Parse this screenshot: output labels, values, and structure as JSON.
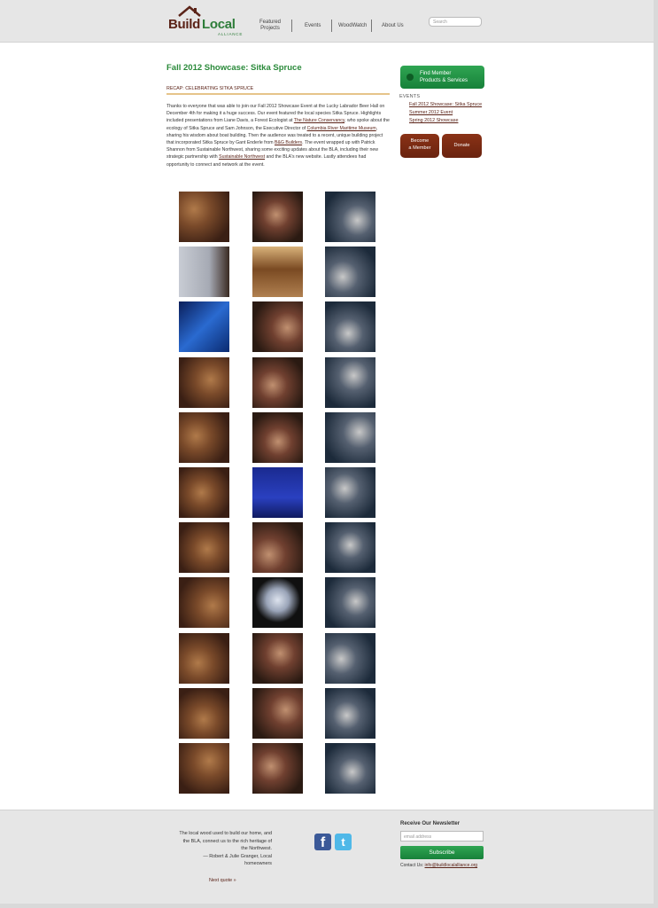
{
  "header": {
    "logo": {
      "word1": "Build",
      "word2": "Local",
      "word3": "ALLIANCE"
    },
    "nav": [
      {
        "label_line1": "Featured",
        "label_line2": "Projects"
      },
      {
        "label_line1": "Events",
        "label_line2": ""
      },
      {
        "label_line1": "WoodWatch",
        "label_line2": ""
      },
      {
        "label_line1": "About Us",
        "label_line2": ""
      }
    ],
    "search_placeholder": "Search"
  },
  "main": {
    "title": "Fall 2012 Showcase: Sitka Spruce",
    "recap_heading": "RECAP: CELEBRATING SITKA SPRUCE",
    "paragraph": {
      "t1": "Thanks to everyone that was able to join our Fall 2012 Showcase Event at the Lucky Labrador Beer Hall on December 4th for making it a huge success. Our event featured the local species Sitka Spruce. Highlights included presentations from Liane Davis, a Forest Ecologist at ",
      "link1": "The Nature Conservancy",
      "t2": ", who spoke about the ecology of Sitka Spruce and Sam Johnson, the Executive Director of ",
      "link2": "Columbia River Maritime Museum",
      "t3": ", sharing his wisdom about boat building. Then the audience was treated to a recent, unique building project that incorporated Sitka Spruce by Gant Enderle from ",
      "link3": "B&G Builders",
      "t4": ". The event wrapped up with Patrick Shannon from Sustainable Northwest, sharing some exciting updates about the BLA, including their new strategic partnership with ",
      "link4": "Sustainable Northwest",
      "t5": " and the BLA's new website. Lastly attendees had opportunity to connect and network at the event."
    },
    "gallery_photos": [
      "event crowd",
      "event crowd",
      "display banner",
      "presentation screen",
      "wood sunglasses",
      "beer hall crowd",
      "blue projection",
      "two attendees",
      "speaker at projector",
      "two women",
      "speaker",
      "man with name tag",
      "attendees talking",
      "woman speaking",
      "attendees talking",
      "two men",
      "Celebrating 10 Years of Excellence slide",
      "man talking",
      "wooden guitar",
      "beer hall crowd",
      "crowd at projection",
      "beer hall interior",
      "B&G Builders slide",
      "man at bar",
      "man standing",
      "two men smiling",
      "three attendees",
      "three men",
      "two men",
      "couple",
      "beer hall",
      "man with beard",
      "group photo"
    ]
  },
  "sidebar": {
    "find_button_line1": "Find Member",
    "find_button_line2": "Products & Services",
    "events_heading": "EVENTS",
    "events": [
      "Fall 2012 Showcase: Sitka Spruce",
      "Summer 2012 Event",
      "Spring 2012 Showcase"
    ],
    "member_button_line1": "Become",
    "member_button_line2": "a Member",
    "donate_button": "Donate"
  },
  "footer": {
    "quote_l1": "The local wood used to build our home, and",
    "quote_l2": "the BLA, connect us to the rich heritage of",
    "quote_l3": "the Northwest.",
    "quote_l4": "— Robert & Julie Granger, Local",
    "quote_l5": "homeowners",
    "next_quote": "Next quote »",
    "newsletter_title": "Receive Our Newsletter",
    "email_placeholder": "email address",
    "subscribe": "Subscribe",
    "contact_label": "Contact Us: ",
    "contact_email": "info@buildlocalalliance.org"
  },
  "colors": {
    "green": "#2a8a3a",
    "brown": "#5b2318",
    "header_bg": "#e6e6e6"
  }
}
